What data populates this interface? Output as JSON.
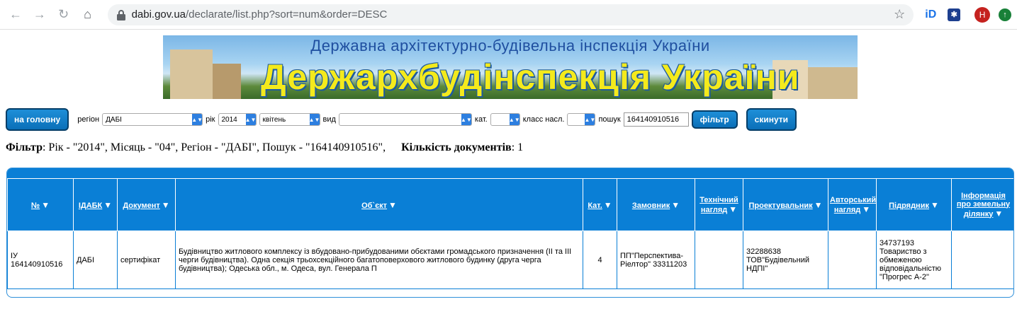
{
  "browser": {
    "url_domain": "dabi.gov.ua",
    "url_path": "/declarate/list.php?sort=num&order=DESC",
    "avatar_letter": "H"
  },
  "banner": {
    "subtitle": "Державна архітектурно-будівельна інспекція України",
    "title": "Держархбудінспекція України"
  },
  "filters": {
    "home_label": "на головну",
    "region_label": "регіон",
    "region_value": "ДАБІ",
    "year_label": "рік",
    "year_value": "2014",
    "month_value": "квітень",
    "type_label": "вид",
    "type_value": "",
    "cat_label": "кат.",
    "cat_value": "",
    "class_label": "класс насл.",
    "class_value": "",
    "search_label": "пошук",
    "search_value": "164140910516",
    "filter_button": "фільтр",
    "reset_button": "скинути"
  },
  "summary": {
    "filter_label": "Фільтр",
    "filter_text": ": Рік - \"2014\", Місяць - \"04\", Регіон - \"ДАБІ\", Пошук - \"164140910516\",",
    "count_label": "Кількість документів",
    "count_value": ": 1"
  },
  "table": {
    "headers": [
      "№",
      "ІДАБК",
      "Документ",
      "Об`єкт",
      "Кат.",
      "Замовник",
      "Технічний нагляд",
      "Проектувальник",
      "Авторський нагляд",
      "Підрядник",
      "Інформація про земельну ділянку"
    ],
    "rows": [
      [
        "ІУ 164140910516",
        "ДАБІ",
        "сертифікат",
        "Будівництво житлового комплексу із вбудовано-прибудованими обєктами громадського призначення (ІІ та ІІІ черги будівництва). Одна секція трьохсекційного багатоповерхового житлового будинку (друга черга будівництва); Одеська обл., м. Одеса, вул. Генерала П",
        "4",
        "ПП\"Перспектива-Ріелтор\" 33311203",
        "",
        "32288638 ТОВ\"Будівельний НДПІ\"",
        "",
        "34737193 Товариство з обмеженою відповідальністю \"Прогрес А-2\"",
        ""
      ]
    ]
  }
}
